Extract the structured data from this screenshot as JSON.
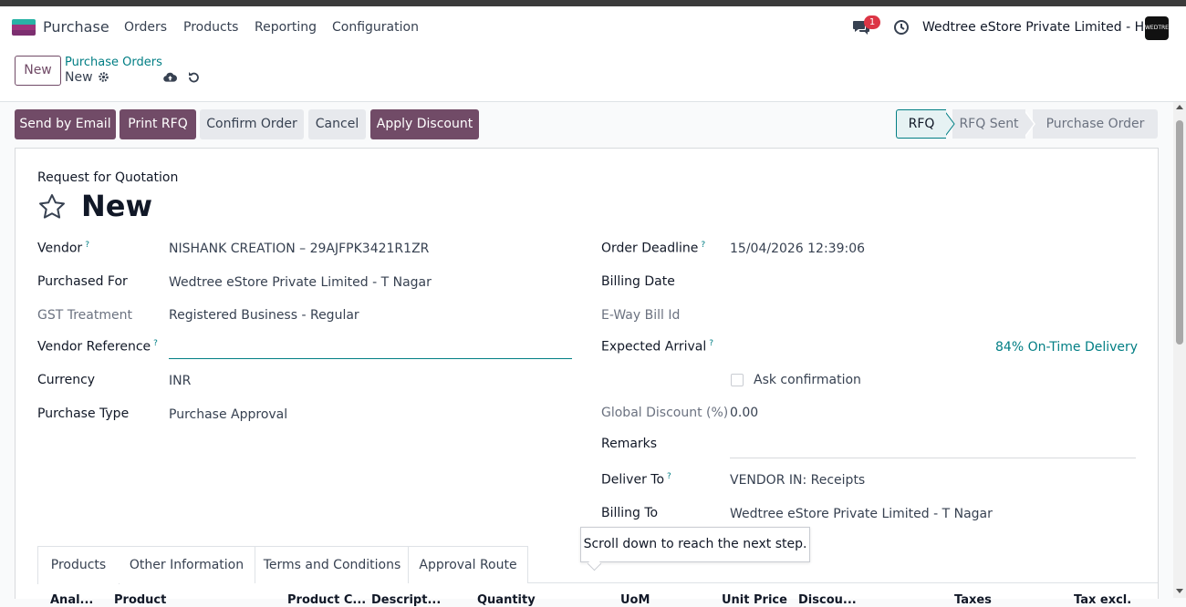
{
  "navbar": {
    "app_name": "Purchase",
    "menu": [
      "Orders",
      "Products",
      "Reporting",
      "Configuration"
    ],
    "chat_badge": "1",
    "company": "Wedtree eStore Private Limited - HO",
    "avatar_text": "WEDTREE"
  },
  "control": {
    "new_label": "New",
    "breadcrumb_parent": "Purchase Orders",
    "breadcrumb_current": "New"
  },
  "actions": {
    "send_email": "Send by Email",
    "print_rfq": "Print RFQ",
    "confirm": "Confirm Order",
    "cancel": "Cancel",
    "apply_discount": "Apply Discount"
  },
  "status": {
    "stages": [
      "RFQ",
      "RFQ Sent",
      "Purchase Order"
    ],
    "active": "RFQ"
  },
  "form": {
    "subtitle": "Request for Quotation",
    "title": "New",
    "vendor_label": "Vendor",
    "vendor_value": "NISHANK CREATION – 29AJFPK3421R1ZR",
    "purchased_for_label": "Purchased For",
    "purchased_for_value": "Wedtree eStore Private Limited - T Nagar",
    "gst_label": "GST Treatment",
    "gst_value": "Registered Business - Regular",
    "vendor_ref_label": "Vendor Reference",
    "currency_label": "Currency",
    "currency_value": "INR",
    "purchase_type_label": "Purchase Type",
    "purchase_type_value": "Purchase Approval",
    "order_deadline_label": "Order Deadline",
    "order_deadline_value": "15/04/2026 12:39:06",
    "billing_date_label": "Billing Date",
    "eway_label": "E-Way Bill Id",
    "expected_arrival_label": "Expected Arrival",
    "on_time": "84% On-Time Delivery",
    "ask_confirmation": "Ask confirmation",
    "global_discount_label": "Global Discount (%)",
    "global_discount_value": "0.00",
    "remarks_label": "Remarks",
    "deliver_to_label": "Deliver To",
    "deliver_to_value": "VENDOR IN: Receipts",
    "billing_to_label": "Billing To",
    "billing_to_value": "Wedtree eStore Private Limited - T Nagar",
    "help_mark": "?"
  },
  "tabs": [
    "Products",
    "Other Information",
    "Terms and Conditions",
    "Approval Route"
  ],
  "columns": [
    "Anal...",
    "Product",
    "Product C...",
    "Descript...",
    "Quantity",
    "UoM",
    "Unit Price",
    "Discou...",
    "Taxes",
    "Tax excl."
  ],
  "tooltip": "Scroll down to reach the next step.",
  "colors": {
    "primary": "#714b67",
    "teal": "#017e84"
  }
}
